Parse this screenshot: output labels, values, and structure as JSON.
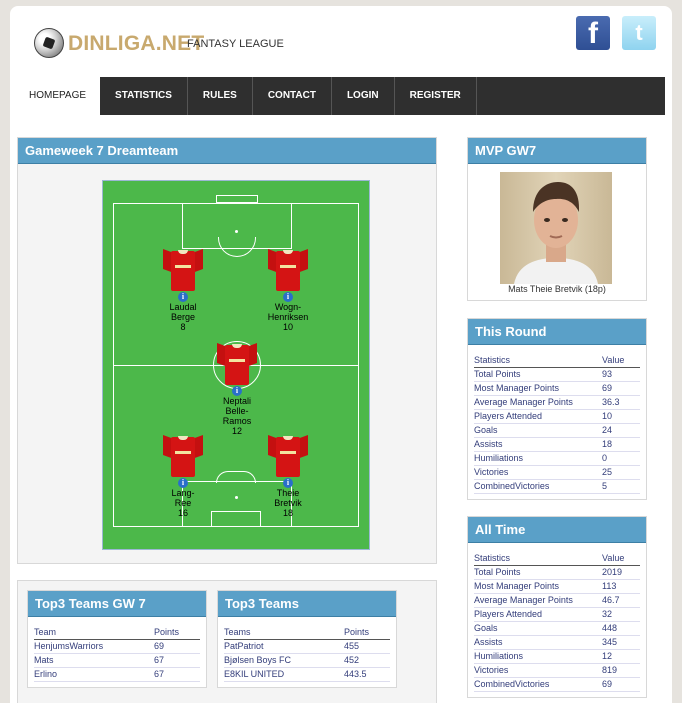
{
  "brand": {
    "name": "DINLIGA.NET",
    "tagline": "FANTASY LEAGUE"
  },
  "social": {
    "facebook": "f",
    "twitter": "t"
  },
  "nav": [
    "HOMEPAGE",
    "STATISTICS",
    "RULES",
    "CONTACT",
    "LOGIN",
    "REGISTER"
  ],
  "dreamteam": {
    "title": "Gameweek 7 Dreamteam",
    "players": [
      {
        "name": "Laudal\nBerge",
        "points": "8"
      },
      {
        "name": "Wogn-\nHenriksen",
        "points": "10"
      },
      {
        "name": "Neptali\nBelle-\nRamos",
        "points": "12"
      },
      {
        "name": "Lang-\nRee",
        "points": "16"
      },
      {
        "name": "Theie\nBretvik",
        "points": "18"
      }
    ],
    "info_icon": "i"
  },
  "mvp": {
    "title": "MVP GW7",
    "caption": "Mats Theie Bretvik (18p)"
  },
  "this_round": {
    "title": "This Round",
    "headers": [
      "Statistics",
      "Value"
    ],
    "rows": [
      [
        "Total Points",
        "93"
      ],
      [
        "Most Manager Points",
        "69"
      ],
      [
        "Average Manager Points",
        "36.3"
      ],
      [
        "Players Attended",
        "10"
      ],
      [
        "Goals",
        "24"
      ],
      [
        "Assists",
        "18"
      ],
      [
        "Humiliations",
        "0"
      ],
      [
        "Victories",
        "25"
      ],
      [
        "CombinedVictories",
        "5"
      ]
    ]
  },
  "all_time": {
    "title": "All Time",
    "headers": [
      "Statistics",
      "Value"
    ],
    "rows": [
      [
        "Total Points",
        "2019"
      ],
      [
        "Most Manager Points",
        "113"
      ],
      [
        "Average Manager Points",
        "46.7"
      ],
      [
        "Players Attended",
        "32"
      ],
      [
        "Goals",
        "448"
      ],
      [
        "Assists",
        "345"
      ],
      [
        "Humiliations",
        "12"
      ],
      [
        "Victories",
        "819"
      ],
      [
        "CombinedVictories",
        "69"
      ]
    ]
  },
  "top3_gw": {
    "title": "Top3 Teams GW 7",
    "headers": [
      "Team",
      "Points"
    ],
    "rows": [
      [
        "HenjumsWarriors",
        "69"
      ],
      [
        "Mats",
        "67"
      ],
      [
        "Erlino",
        "67"
      ]
    ]
  },
  "top3": {
    "title": "Top3 Teams",
    "headers": [
      "Teams",
      "Points"
    ],
    "rows": [
      [
        "PatPatriot",
        "455"
      ],
      [
        "Bjølsen Boys FC",
        "452"
      ],
      [
        "E8KIL UNITED",
        "443.5"
      ]
    ]
  }
}
